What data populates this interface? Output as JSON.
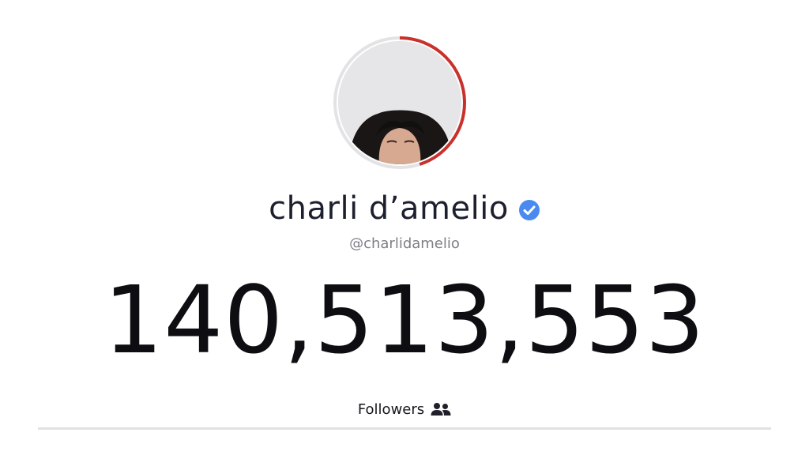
{
  "profile": {
    "display_name": "charli d’amelio",
    "handle": "@charlidamelio",
    "verified_icon": "verified-check-icon",
    "avatar_icon": "profile-photo",
    "ring_progress": 0.45
  },
  "stats": {
    "follower_count": "140,513,553",
    "followers_label": "Followers",
    "followers_icon": "people-icon"
  },
  "colors": {
    "ring_progress": "#c8312c",
    "ring_track": "#e3e3e5",
    "verified": "#4a8af0",
    "text_primary": "#1c1f2e",
    "text_secondary": "#7d7f86",
    "divider": "#e2e2e4"
  }
}
